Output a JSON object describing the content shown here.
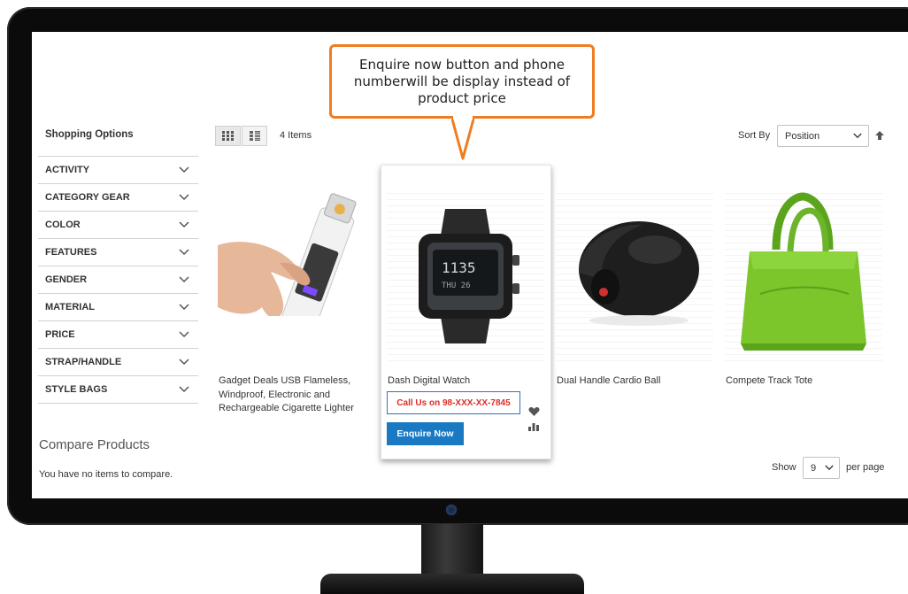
{
  "callout": {
    "text": "Enquire now button and phone numberwill be display instead of product price"
  },
  "sidebar": {
    "title": "Shopping Options",
    "filters": [
      {
        "label": "ACTIVITY"
      },
      {
        "label": "CATEGORY GEAR"
      },
      {
        "label": "COLOR"
      },
      {
        "label": "FEATURES"
      },
      {
        "label": "GENDER"
      },
      {
        "label": "MATERIAL"
      },
      {
        "label": "PRICE"
      },
      {
        "label": "STRAP/HANDLE"
      },
      {
        "label": "STYLE BAGS"
      }
    ],
    "compare": {
      "title": "Compare Products",
      "empty_text": "You have no items to compare."
    }
  },
  "toolbar": {
    "items_count": "4 Items",
    "sort_label": "Sort By",
    "sort_value": "Position",
    "show_label": "Show",
    "limit_value": "9",
    "per_page_label": "per page"
  },
  "products": [
    {
      "name": "Gadget Deals USB Flameless, Windproof, Electronic and Rechargeable Cigarette Lighter"
    },
    {
      "name": "Dash Digital Watch",
      "phone_text": "Call Us on 98-XXX-XX-7845",
      "enquire_label": "Enquire Now"
    },
    {
      "name": "Dual Handle Cardio Ball"
    },
    {
      "name": "Compete Track Tote"
    }
  ],
  "colors": {
    "accent": "#1979c3",
    "callout_border": "#f07d22",
    "phone_text": "#e02b27",
    "bag_green": "#7cc52a"
  },
  "icons": [
    "chevron-down-icon",
    "grid-icon",
    "list-icon",
    "arrow-up-icon",
    "heart-icon",
    "compare-bars-icon",
    "webcam-icon"
  ]
}
